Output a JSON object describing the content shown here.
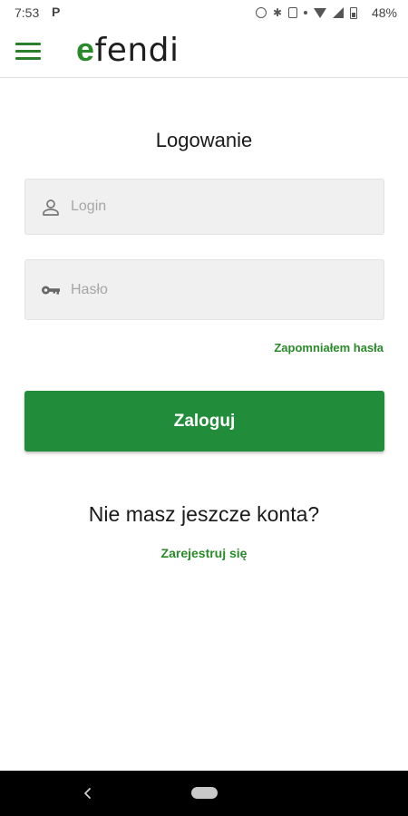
{
  "status_bar": {
    "time": "7:53",
    "notification_letter": "P",
    "battery_percent": "48%",
    "icons": [
      "alarm-icon",
      "bluetooth-icon",
      "vibrate-icon",
      "dot-icon",
      "wifi-icon",
      "signal-icon",
      "battery-icon"
    ]
  },
  "header": {
    "menu_icon": "hamburger-menu-icon",
    "logo": {
      "first_letter": "e",
      "rest": "fendi"
    },
    "colors": {
      "brand_green": "#2a8a2a"
    }
  },
  "login_form": {
    "title": "Logowanie",
    "login_field": {
      "placeholder": "Login",
      "value": "",
      "icon": "user-icon"
    },
    "password_field": {
      "placeholder": "Hasło",
      "value": "",
      "icon": "key-icon"
    },
    "forgot_password": "Zapomniałem hasła",
    "submit_label": "Zaloguj",
    "colors": {
      "button": "#218c3a",
      "link": "#2a8a2a",
      "field_background": "#f0f0f0"
    }
  },
  "register": {
    "prompt": "Nie masz jeszcze konta?",
    "link": "Zarejestruj się"
  },
  "nav_bar": {
    "icons": [
      "back-icon",
      "home-pill-icon"
    ]
  }
}
